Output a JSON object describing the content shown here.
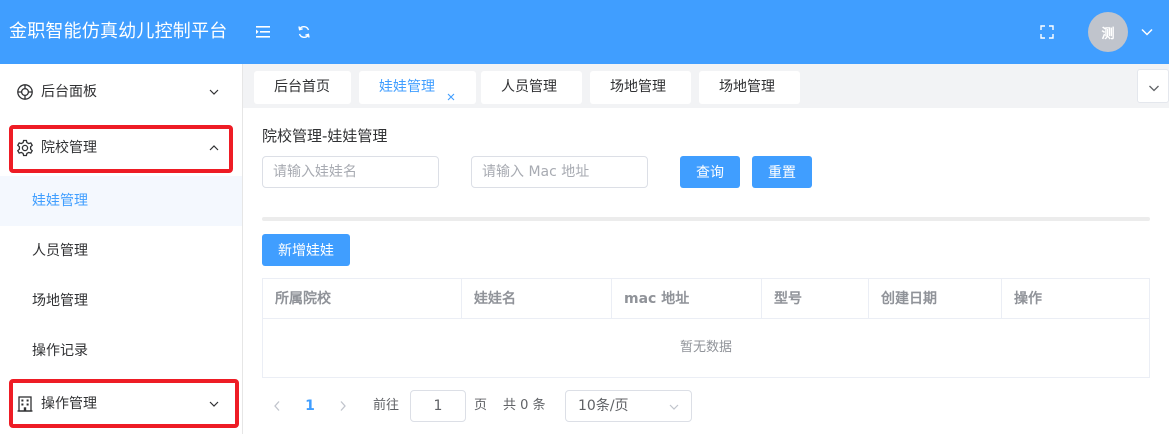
{
  "app": {
    "title": "金职智能仿真幼儿控制平台",
    "brand_color": "#409eff",
    "avatar_text": "测"
  },
  "header_icons": [
    "menu-collapse-icon",
    "refresh-icon",
    "fullscreen-icon",
    "chevron-down-icon"
  ],
  "sidebar": {
    "items": [
      {
        "label": "后台面板",
        "icon": "dashboard-icon",
        "expanded": false
      },
      {
        "label": "院校管理",
        "icon": "gear-icon",
        "expanded": true,
        "highlighted": true
      },
      {
        "label": "操作管理",
        "icon": "building-icon",
        "expanded": false,
        "highlighted": true
      }
    ],
    "sub_items": [
      {
        "label": "娃娃管理",
        "active": true
      },
      {
        "label": "人员管理",
        "active": false
      },
      {
        "label": "场地管理",
        "active": false
      },
      {
        "label": "操作记录",
        "active": false
      }
    ]
  },
  "tabs": [
    {
      "label": "后台首页",
      "active": false
    },
    {
      "label": "娃娃管理",
      "active": true,
      "closable": true
    },
    {
      "label": "人员管理",
      "active": false
    },
    {
      "label": "场地管理",
      "active": false
    },
    {
      "label": "场地管理",
      "active": false
    }
  ],
  "main": {
    "title": "院校管理-娃娃管理",
    "search": {
      "name_placeholder": "请输入娃娃名",
      "mac_placeholder": "请输入 Mac 地址",
      "query_label": "查询",
      "reset_label": "重置"
    },
    "add_button_label": "新增娃娃",
    "table": {
      "columns": [
        "所属院校",
        "娃娃名",
        "mac 地址",
        "型号",
        "创建日期",
        "操作"
      ],
      "rows": [],
      "empty_text": "暂无数据"
    },
    "pagination": {
      "current_page": "1",
      "goto_label": "前往",
      "goto_value": "1",
      "page_unit": "页",
      "total_text": "共 0 条",
      "page_size_label": "10条/页"
    }
  },
  "colors": {
    "highlight_box": "#ee1c25",
    "active_text": "#409eff"
  }
}
